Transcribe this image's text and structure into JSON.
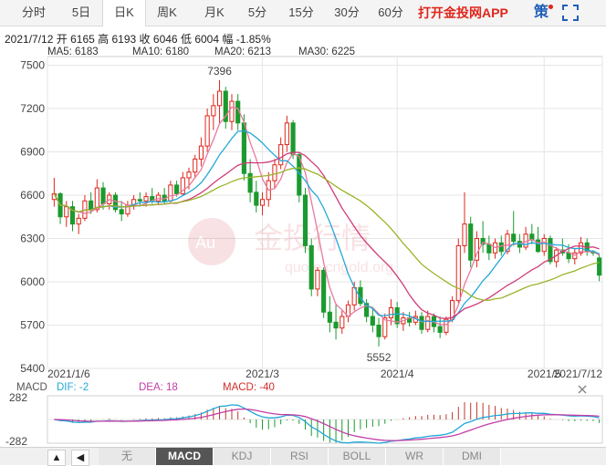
{
  "tabs": [
    {
      "label": "分时",
      "active": false
    },
    {
      "label": "5日",
      "active": false
    },
    {
      "label": "日K",
      "active": true
    },
    {
      "label": "周K",
      "active": false
    },
    {
      "label": "月K",
      "active": false
    },
    {
      "label": "5分",
      "active": false
    },
    {
      "label": "15分",
      "active": false
    },
    {
      "label": "30分",
      "active": false
    },
    {
      "label": "60分",
      "active": false
    }
  ],
  "promo": "打开金投网APP",
  "header_icons": {
    "strategy": "策",
    "strategy_icon": "ce-icon",
    "fullscreen_icon": "fullscreen-icon"
  },
  "quote": {
    "date": "2021/7/12",
    "open_label": "开",
    "open": "6165",
    "high_label": "高",
    "high": "6193",
    "close_label": "收",
    "close": "6046",
    "low_label": "低",
    "low": "6004",
    "change_label": "幅",
    "change": "-1.85%"
  },
  "ma": [
    {
      "label": "MA5: 6183",
      "color": "#e8799f"
    },
    {
      "label": "MA10: 6180",
      "color": "#23a8d8"
    },
    {
      "label": "MA20: 6213",
      "color": "#d03b79"
    },
    {
      "label": "MA30: 6225",
      "color": "#9ab42a"
    }
  ],
  "indicator_legend": [
    {
      "label": "MACD",
      "color": "#555555"
    },
    {
      "label": "DIF: -2",
      "color": "#23a8d8"
    },
    {
      "label": "DEA: 18",
      "color": "#c23da7"
    },
    {
      "label": "MACD: -40",
      "color": "#d22b2b"
    }
  ],
  "indicator_tabs": [
    {
      "label": "无",
      "active": false
    },
    {
      "label": "MACD",
      "active": true
    },
    {
      "label": "KDJ",
      "active": false
    },
    {
      "label": "RSI",
      "active": false
    },
    {
      "label": "BOLL",
      "active": false
    },
    {
      "label": "WR",
      "active": false
    },
    {
      "label": "DMI",
      "active": false
    }
  ],
  "arrows": {
    "up": "▲",
    "down": "◀"
  },
  "watermark": {
    "text": "金投行情",
    "sub": "quote.cngold.org",
    "badge": "Au"
  },
  "colors": {
    "up": "#e0251b",
    "down": "#1b9a2f",
    "promo": "#e0251b",
    "active_tab": "#555555"
  },
  "chart_data": {
    "type": "candlestick",
    "y_ticks": [
      "7500",
      "7200",
      "6900",
      "6600",
      "6300",
      "6000",
      "5700",
      "5400"
    ],
    "ylim": [
      5400,
      7560
    ],
    "x_ticks": [
      "2021/1/6",
      "2021/3",
      "2021/4",
      "2021/5",
      "2021/7/12"
    ],
    "annotations": [
      "7396",
      "5552"
    ],
    "macd_ticks": [
      "282",
      "-282"
    ],
    "candles": [
      [
        6570,
        6720,
        6520,
        6610
      ],
      [
        6610,
        6620,
        6400,
        6450
      ],
      [
        6450,
        6560,
        6380,
        6520
      ],
      [
        6520,
        6560,
        6350,
        6400
      ],
      [
        6400,
        6470,
        6330,
        6440
      ],
      [
        6440,
        6600,
        6420,
        6560
      ],
      [
        6560,
        6620,
        6470,
        6500
      ],
      [
        6500,
        6710,
        6480,
        6650
      ],
      [
        6650,
        6690,
        6500,
        6540
      ],
      [
        6540,
        6620,
        6500,
        6600
      ],
      [
        6600,
        6620,
        6480,
        6500
      ],
      [
        6500,
        6560,
        6420,
        6470
      ],
      [
        6470,
        6560,
        6450,
        6530
      ],
      [
        6530,
        6600,
        6500,
        6570
      ],
      [
        6570,
        6620,
        6530,
        6560
      ],
      [
        6560,
        6620,
        6520,
        6590
      ],
      [
        6590,
        6650,
        6540,
        6560
      ],
      [
        6560,
        6620,
        6530,
        6600
      ],
      [
        6600,
        6650,
        6540,
        6560
      ],
      [
        6560,
        6700,
        6550,
        6670
      ],
      [
        6670,
        6700,
        6590,
        6610
      ],
      [
        6610,
        6760,
        6600,
        6720
      ],
      [
        6720,
        6790,
        6640,
        6760
      ],
      [
        6760,
        6880,
        6720,
        6850
      ],
      [
        6850,
        7000,
        6800,
        6940
      ],
      [
        6940,
        7200,
        6900,
        7150
      ],
      [
        7150,
        7300,
        7050,
        7220
      ],
      [
        7220,
        7396,
        7100,
        7320
      ],
      [
        7320,
        7350,
        7060,
        7110
      ],
      [
        7110,
        7300,
        7050,
        7250
      ],
      [
        7250,
        7300,
        7050,
        7100
      ],
      [
        7100,
        7160,
        6700,
        6750
      ],
      [
        6750,
        6850,
        6550,
        6620
      ],
      [
        6620,
        6700,
        6480,
        6530
      ],
      [
        6530,
        6620,
        6460,
        6570
      ],
      [
        6570,
        6760,
        6520,
        6700
      ],
      [
        6700,
        6850,
        6650,
        6810
      ],
      [
        6810,
        7000,
        6780,
        6950
      ],
      [
        6950,
        7150,
        6900,
        7100
      ],
      [
        7100,
        7120,
        6850,
        6880
      ],
      [
        6880,
        6900,
        6550,
        6600
      ],
      [
        6600,
        6650,
        6200,
        6250
      ],
      [
        6250,
        6300,
        5900,
        5950
      ],
      [
        5950,
        6100,
        5900,
        6080
      ],
      [
        6080,
        6100,
        5750,
        5790
      ],
      [
        5790,
        5900,
        5650,
        5720
      ],
      [
        5720,
        5850,
        5600,
        5680
      ],
      [
        5680,
        5800,
        5640,
        5760
      ],
      [
        5760,
        5870,
        5720,
        5840
      ],
      [
        5840,
        6000,
        5800,
        5960
      ],
      [
        5960,
        6010,
        5830,
        5850
      ],
      [
        5850,
        5880,
        5720,
        5760
      ],
      [
        5760,
        5820,
        5650,
        5700
      ],
      [
        5700,
        5750,
        5552,
        5620
      ],
      [
        5620,
        5780,
        5600,
        5750
      ],
      [
        5750,
        5880,
        5700,
        5820
      ],
      [
        5820,
        5860,
        5680,
        5710
      ],
      [
        5710,
        5790,
        5660,
        5750
      ],
      [
        5750,
        5790,
        5690,
        5720
      ],
      [
        5720,
        5800,
        5700,
        5760
      ],
      [
        5760,
        5790,
        5640,
        5670
      ],
      [
        5670,
        5800,
        5650,
        5760
      ],
      [
        5760,
        5780,
        5650,
        5690
      ],
      [
        5690,
        5760,
        5610,
        5650
      ],
      [
        5650,
        5760,
        5630,
        5740
      ],
      [
        5740,
        5900,
        5720,
        5870
      ],
      [
        5870,
        6300,
        5850,
        6250
      ],
      [
        6250,
        6620,
        6200,
        6400
      ],
      [
        6400,
        6450,
        6100,
        6150
      ],
      [
        6150,
        6350,
        6100,
        6300
      ],
      [
        6300,
        6420,
        6200,
        6260
      ],
      [
        6260,
        6320,
        6150,
        6200
      ],
      [
        6200,
        6300,
        6160,
        6270
      ],
      [
        6270,
        6320,
        6180,
        6210
      ],
      [
        6210,
        6360,
        6190,
        6330
      ],
      [
        6330,
        6490,
        6250,
        6280
      ],
      [
        6280,
        6330,
        6200,
        6240
      ],
      [
        6240,
        6380,
        6220,
        6330
      ],
      [
        6330,
        6400,
        6260,
        6290
      ],
      [
        6290,
        6380,
        6200,
        6210
      ],
      [
        6210,
        6330,
        6180,
        6300
      ],
      [
        6300,
        6320,
        6120,
        6140
      ],
      [
        6140,
        6240,
        6100,
        6220
      ],
      [
        6220,
        6300,
        6180,
        6200
      ],
      [
        6200,
        6260,
        6130,
        6160
      ],
      [
        6160,
        6230,
        6120,
        6200
      ],
      [
        6200,
        6310,
        6180,
        6270
      ],
      [
        6270,
        6300,
        6180,
        6210
      ],
      [
        6210,
        6220,
        6180,
        6200
      ],
      [
        6165,
        6193,
        6004,
        6046
      ]
    ]
  }
}
